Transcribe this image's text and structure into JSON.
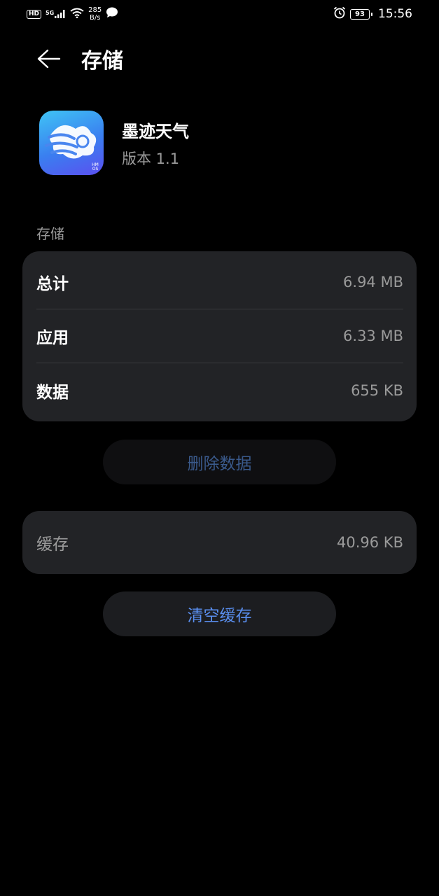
{
  "status_bar": {
    "hd": "HD",
    "signal": "5G",
    "net_speed_value": "285",
    "net_speed_unit": "B/s",
    "battery": "93",
    "time": "15:56"
  },
  "header": {
    "title": "存储"
  },
  "app": {
    "name": "墨迹天气",
    "version": "版本 1.1",
    "icon_badge": "HMOS"
  },
  "storage": {
    "section_label": "存储",
    "rows": [
      {
        "label": "总计",
        "value": "6.94 MB"
      },
      {
        "label": "应用",
        "value": "6.33 MB"
      },
      {
        "label": "数据",
        "value": "655 KB"
      }
    ]
  },
  "delete_data_button": "删除数据",
  "cache": {
    "label": "缓存",
    "value": "40.96 KB"
  },
  "clear_cache_button": "清空缓存"
}
